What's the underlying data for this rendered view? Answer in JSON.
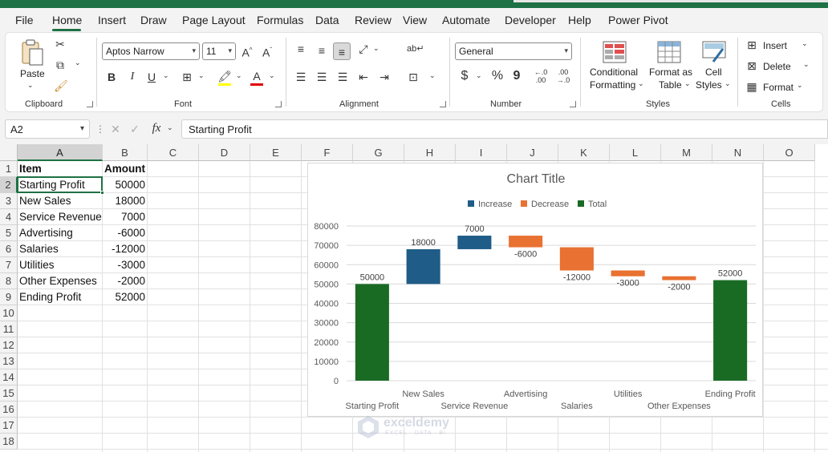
{
  "menu": {
    "tabs": [
      "File",
      "Home",
      "Insert",
      "Draw",
      "Page Layout",
      "Formulas",
      "Data",
      "Review",
      "View",
      "Automate",
      "Developer",
      "Help",
      "Power Pivot"
    ],
    "active": "Home"
  },
  "ribbon": {
    "clipboard": {
      "paste": "Paste",
      "label": "Clipboard"
    },
    "font": {
      "name": "Aptos Narrow",
      "size": "11",
      "bold": "B",
      "italic": "I",
      "underline": "U",
      "label": "Font"
    },
    "alignment": {
      "label": "Alignment"
    },
    "number": {
      "format": "General",
      "currency": "$",
      "percent": "%",
      "comma": "9",
      "inc_decimal": ".00",
      "label": "Number"
    },
    "styles": {
      "conditional_1": "Conditional",
      "conditional_2": "Formatting",
      "format_table_1": "Format as",
      "format_table_2": "Table",
      "cell_styles_1": "Cell",
      "cell_styles_2": "Styles",
      "label": "Styles"
    },
    "cells": {
      "insert": "Insert",
      "delete": "Delete",
      "format": "Format",
      "label": "Cells"
    }
  },
  "formula_bar": {
    "name_box": "A2",
    "fx": "fx",
    "formula": "Starting Profit"
  },
  "sheet": {
    "columns": [
      "A",
      "B",
      "C",
      "D",
      "E",
      "F",
      "G",
      "H",
      "I",
      "J",
      "K",
      "L",
      "M",
      "N",
      "O"
    ],
    "rows": [
      "1",
      "2",
      "3",
      "4",
      "5",
      "6",
      "7",
      "8",
      "9",
      "10",
      "11",
      "12",
      "13",
      "14",
      "15",
      "16",
      "17",
      "18"
    ],
    "headers": {
      "item": "Item",
      "amount": "Amount"
    },
    "data": [
      {
        "item": "Starting Profit",
        "amount": "50000"
      },
      {
        "item": "New Sales",
        "amount": "18000"
      },
      {
        "item": "Service Revenue",
        "amount": "7000"
      },
      {
        "item": "Advertising",
        "amount": "-6000"
      },
      {
        "item": "Salaries",
        "amount": "-12000"
      },
      {
        "item": "Utilities",
        "amount": "-3000"
      },
      {
        "item": "Other Expenses",
        "amount": "-2000"
      },
      {
        "item": "Ending Profit",
        "amount": "52000"
      }
    ]
  },
  "colors": {
    "increase": "#1f5c87",
    "decrease": "#e97132",
    "total": "#196b24",
    "excel_green": "#1e7145"
  },
  "watermark": {
    "name": "exceldemy",
    "tagline": "EXCEL · DATA · BI"
  },
  "chart_data": {
    "type": "bar",
    "title": "Chart Title",
    "legend": [
      "Increase",
      "Decrease",
      "Total"
    ],
    "legend_position": "top",
    "categories": [
      "Starting Profit",
      "New Sales",
      "Service Revenue",
      "Advertising",
      "Salaries",
      "Utilities",
      "Other Expenses",
      "Ending Profit"
    ],
    "values": [
      50000,
      18000,
      7000,
      -6000,
      -12000,
      -3000,
      -2000,
      52000
    ],
    "kinds": [
      "total",
      "increase",
      "increase",
      "decrease",
      "decrease",
      "decrease",
      "decrease",
      "total"
    ],
    "ylim": [
      0,
      80000
    ],
    "yticks": [
      0,
      10000,
      20000,
      30000,
      40000,
      50000,
      60000,
      70000,
      80000
    ],
    "grid": true
  }
}
